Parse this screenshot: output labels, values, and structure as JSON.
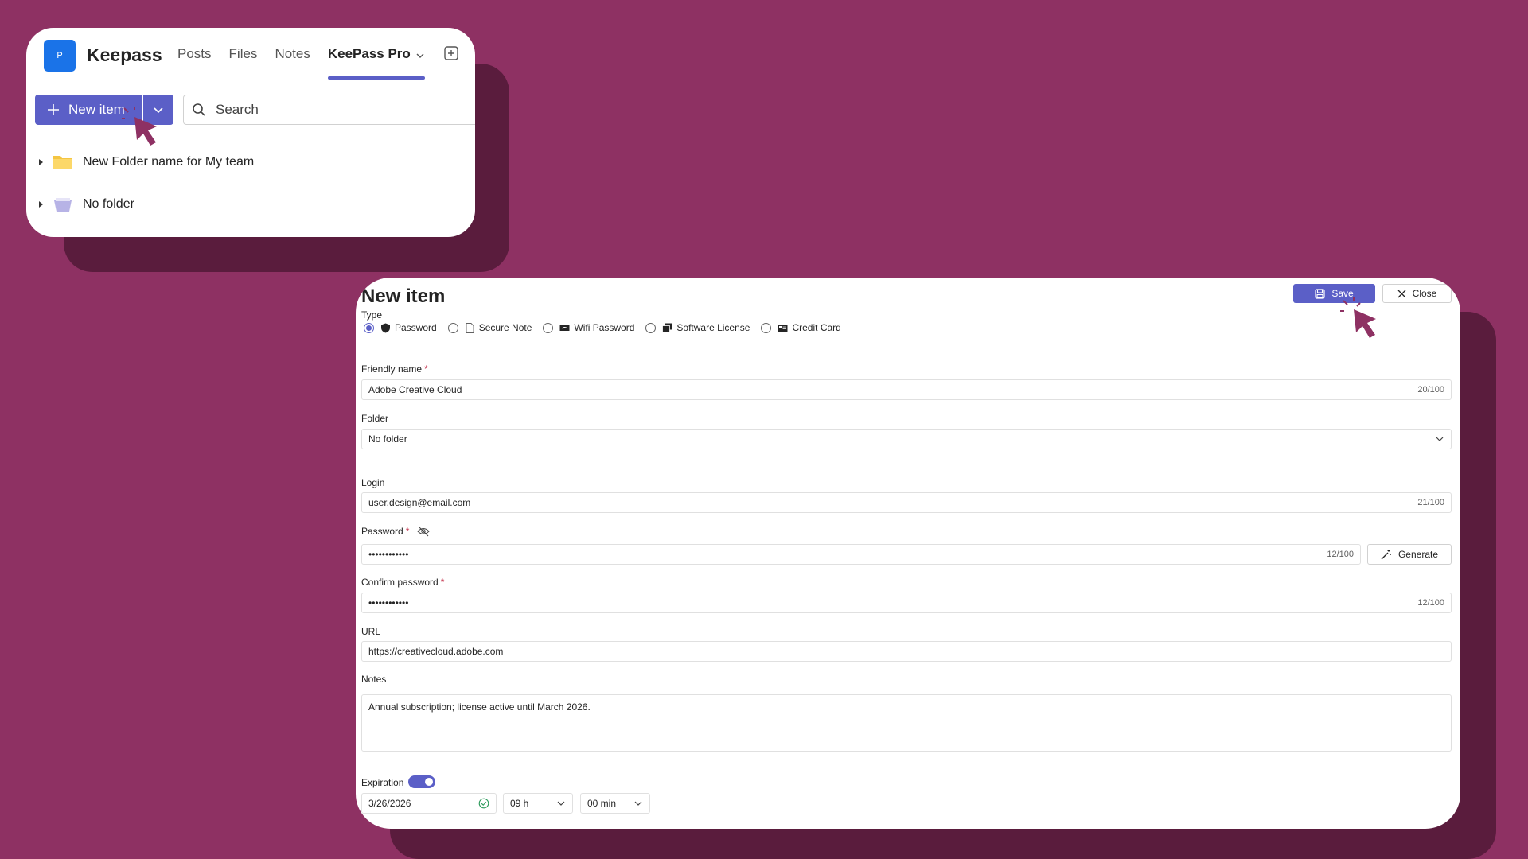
{
  "app": {
    "logo_letter": "P",
    "title": "Keepass",
    "tabs": [
      {
        "label": "Posts"
      },
      {
        "label": "Files"
      },
      {
        "label": "Notes"
      },
      {
        "label": "KeePass Pro"
      }
    ],
    "active_tab": "KeePass Pro"
  },
  "toolbar": {
    "new_item_label": "New item",
    "search_placeholder": "Search"
  },
  "folders": [
    {
      "label": "New Folder name for My team",
      "icon": "folder-icon"
    },
    {
      "label": "No folder",
      "icon": "no-folder-icon"
    }
  ],
  "form": {
    "title": "New item",
    "save_label": "Save",
    "close_label": "Close",
    "type_label": "Type",
    "types": [
      {
        "label": "Password",
        "icon": "shield-icon",
        "selected": true
      },
      {
        "label": "Secure Note",
        "icon": "note-icon",
        "selected": false
      },
      {
        "label": "Wifi Password",
        "icon": "wifi-card-icon",
        "selected": false
      },
      {
        "label": "Software License",
        "icon": "license-icon",
        "selected": false
      },
      {
        "label": "Credit Card",
        "icon": "credit-card-icon",
        "selected": false
      }
    ],
    "friendly_name": {
      "label": "Friendly name",
      "value": "Adobe Creative Cloud",
      "count": "20/100"
    },
    "folder": {
      "label": "Folder",
      "value": "No folder"
    },
    "login": {
      "label": "Login",
      "value": "user.design@email.com",
      "count": "21/100"
    },
    "password": {
      "label": "Password",
      "value": "••••••••••••",
      "count": "12/100",
      "generate_label": "Generate"
    },
    "confirm_password": {
      "label": "Confirm password",
      "value": "••••••••••••",
      "count": "12/100"
    },
    "url": {
      "label": "URL",
      "value": "https://creativecloud.adobe.com"
    },
    "notes": {
      "label": "Notes",
      "value": "Annual subscription; license active until March 2026."
    },
    "expiration": {
      "label": "Expiration",
      "enabled": true,
      "date": "3/26/2026",
      "hour": "09 h",
      "minute": "00 min"
    }
  },
  "colors": {
    "background": "#8e3163",
    "accent": "#5b5fc7",
    "cursor": "#8e3163"
  }
}
